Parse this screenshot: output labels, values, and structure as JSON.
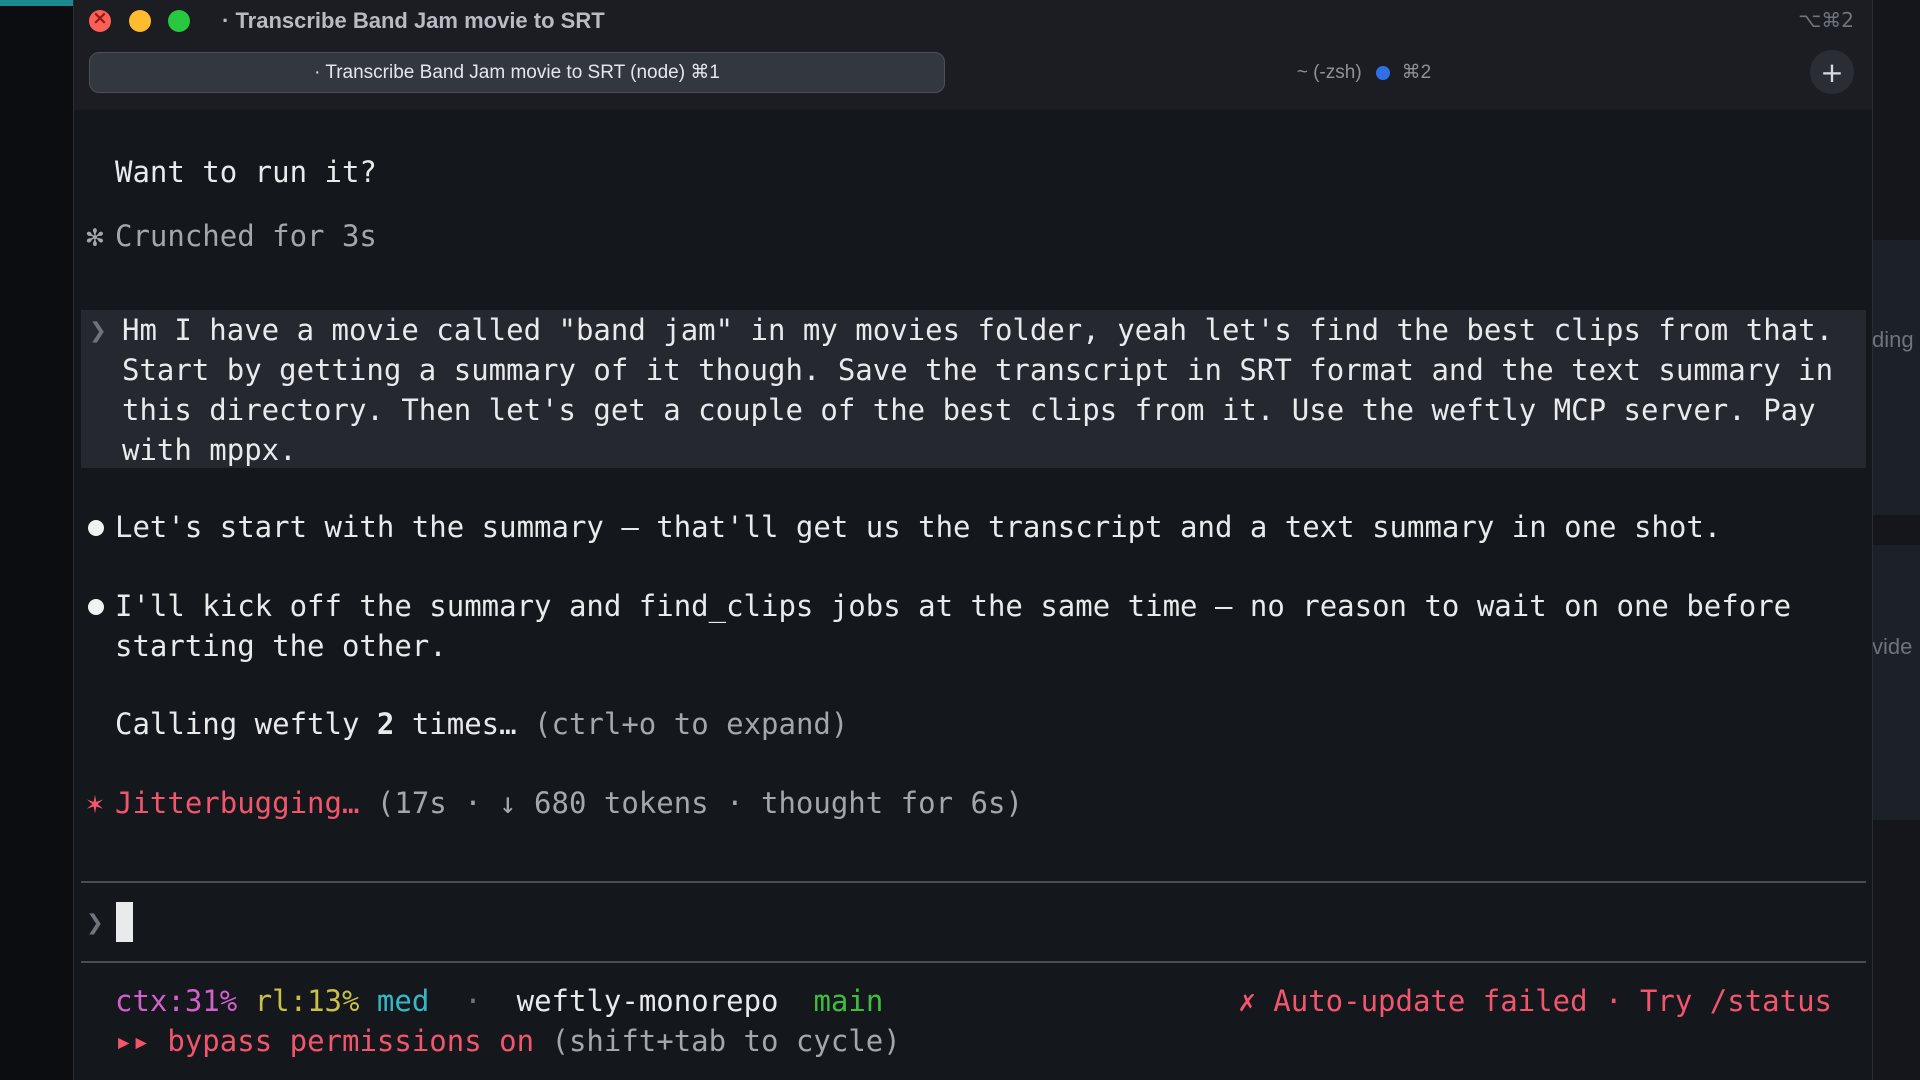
{
  "window": {
    "title": "· Transcribe Band Jam movie to SRT",
    "shortcut": "⌥⌘2"
  },
  "tabs": [
    {
      "label": "· Transcribe Band Jam movie to SRT (node) ⌘1",
      "active": true
    },
    {
      "label": "~ (-zsh)",
      "shortcut": "⌘2",
      "active": false
    }
  ],
  "new_tab_label": "+",
  "background_fragments": {
    "top": "ding",
    "bottom": "vide"
  },
  "terminal": {
    "question": "Want to run it?",
    "crunched": {
      "glyph": "✻",
      "text": "Crunched for 3s"
    },
    "user_prompt": {
      "glyph": "❯",
      "text": "Hm I have a movie called \"band jam\" in my movies folder, yeah let's find the best clips from that.\nStart by getting a summary of it though. Save the transcript in SRT format and the text summary in\nthis directory. Then let's get a couple of the best clips from it. Use the weftly MCP server. Pay\nwith mppx."
    },
    "messages": [
      "Let's start with the summary — that'll get us the transcript and a text summary in one shot.",
      "I'll kick off the summary and find_clips jobs at the same time — no reason to wait on one before\nstarting the other."
    ],
    "tool_call": {
      "prefix": "Calling weftly ",
      "count": "2",
      "suffix": " times…",
      "hint": " (ctrl+o to expand)"
    },
    "activity": {
      "glyph": "✶",
      "verb": "Jitterbugging…",
      "details": " (17s · ↓ 680 tokens · thought for 6s)"
    },
    "input": {
      "glyph": "❯",
      "value": ""
    },
    "status": {
      "ctx": "ctx:31%",
      "rl": "rl:13%",
      "level": "med",
      "sep": "·",
      "repo": "weftly-monorepo",
      "branch": "main",
      "error": "✗ Auto-update failed · Try /status",
      "mode_glyph": "▸▸",
      "mode": "bypass permissions on",
      "mode_hint": " (shift+tab to cycle)"
    }
  },
  "colors": {
    "accent_red": "#f2556c",
    "ctx_magenta": "#d45fcf",
    "rl_yellow": "#c9c04a",
    "med_cyan": "#35b9c6",
    "branch_green": "#3fbd3f",
    "tab_dot_blue": "#2f6fe8"
  }
}
